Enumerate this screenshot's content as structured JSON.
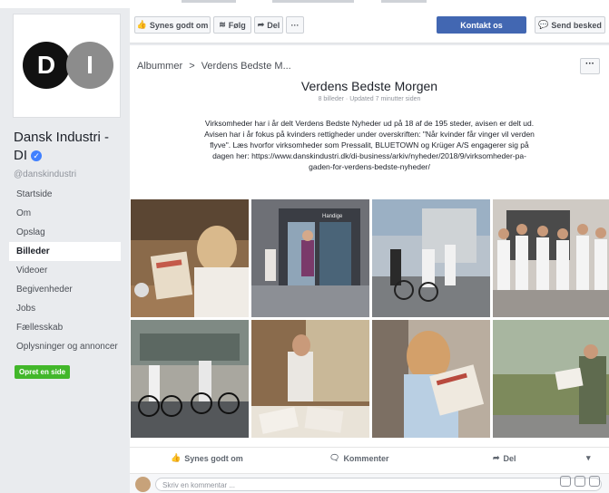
{
  "sidebar": {
    "logo_letters": [
      "D",
      "I"
    ],
    "page_name": "Dansk Industri - DI",
    "handle": "@danskindustri",
    "nav": [
      {
        "label": "Startside"
      },
      {
        "label": "Om"
      },
      {
        "label": "Opslag"
      },
      {
        "label": "Billeder"
      },
      {
        "label": "Videoer"
      },
      {
        "label": "Begivenheder"
      },
      {
        "label": "Jobs"
      },
      {
        "label": "Fællesskab"
      },
      {
        "label": "Oplysninger og annoncer"
      }
    ],
    "create_page": "Opret en side"
  },
  "action_bar": {
    "like": "Synes godt om",
    "follow": "Følg",
    "share": "Del",
    "more": "···",
    "contact": "Kontakt os",
    "send_message": "Send besked"
  },
  "album": {
    "breadcrumb_root": "Albummer",
    "breadcrumb_sep": ">",
    "breadcrumb_current": "Verdens Bedste M...",
    "more": "···",
    "title": "Verdens Bedste Morgen",
    "meta": "8 billeder · Updated 7 minutter siden",
    "description": "Virksomheder har i år delt Verdens Bedste Nyheder ud på 18 af de 195 steder, avisen er delt ud. Avisen har i år fokus på kvinders rettigheder under overskriften: \"Når kvinder får vinger vil verden flyve\". Læs hvorfor virksomheder som Pressalit, BLUETOWN og Krüger A/S engagerer sig på dagen her: https://www.danskindustri.dk/di-business/arkiv/nyheder/2018/9/virksomheder-pa-gaden-for-verdens-bedste-nyheder/"
  },
  "photo_sign": "Handige",
  "actions": {
    "like": "Synes godt om",
    "comment": "Kommenter",
    "share": "Del"
  },
  "comment": {
    "placeholder": "Skriv en kommentar ..."
  },
  "colors": {
    "facebook_blue": "#4267b2",
    "green": "#42b72a",
    "background": "#e9ebee"
  }
}
